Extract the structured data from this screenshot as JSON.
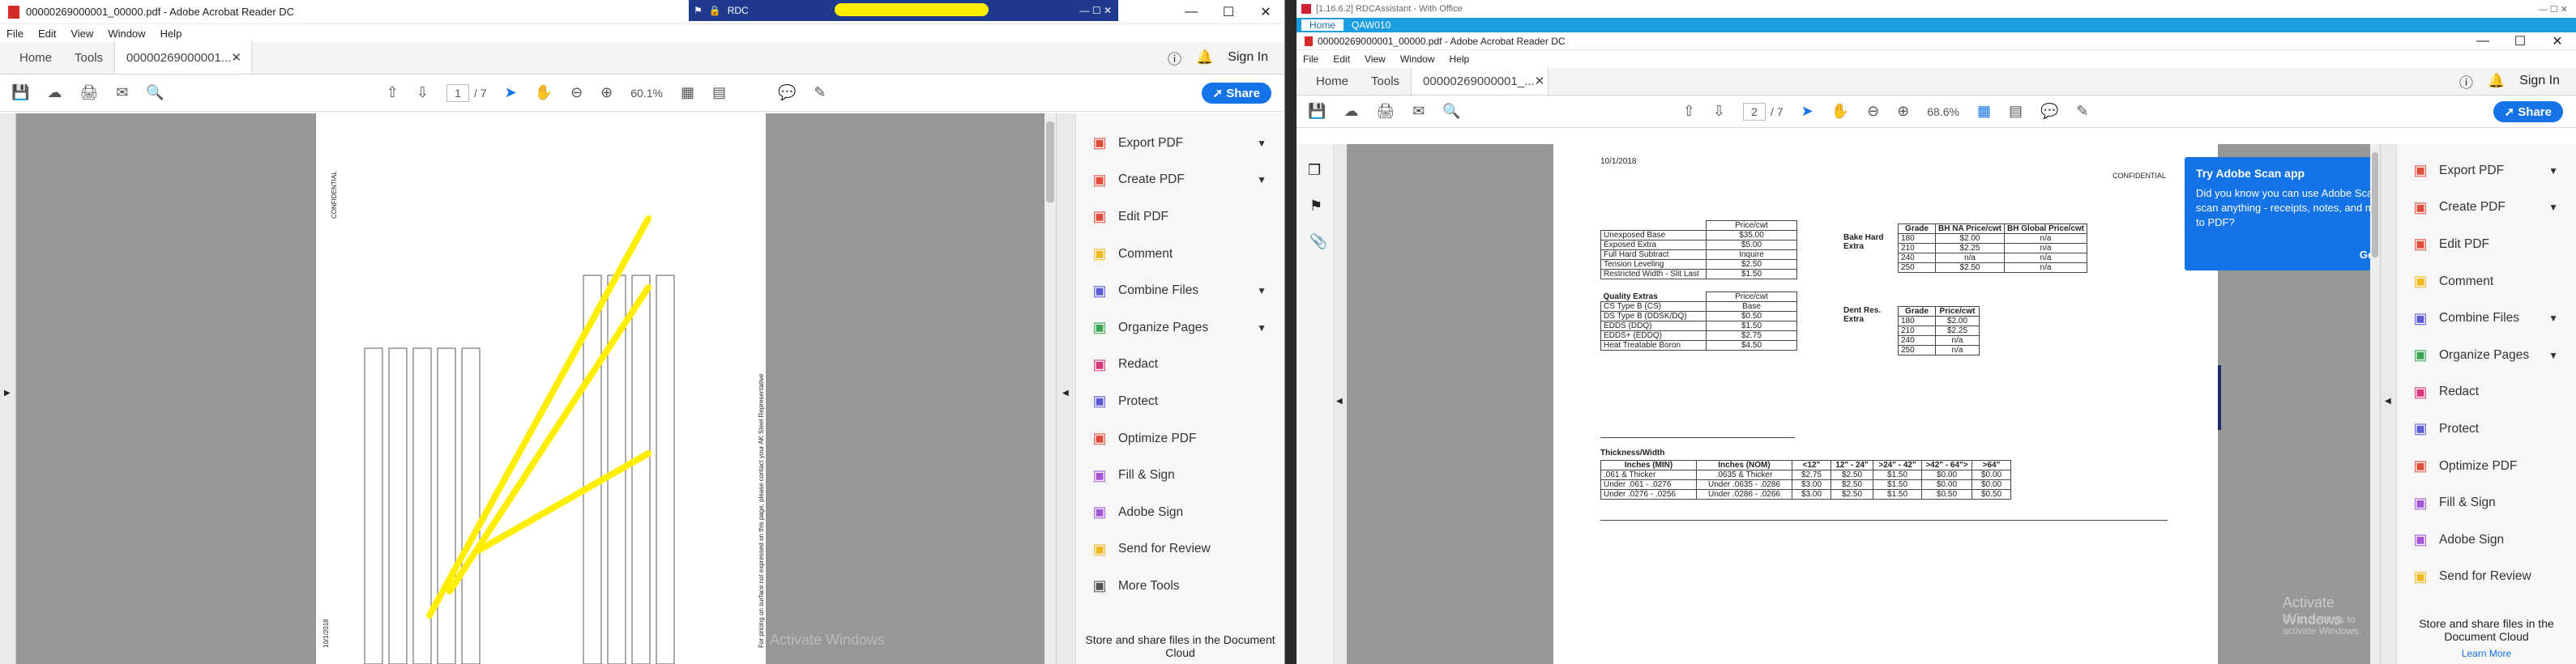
{
  "left_window": {
    "title": "00000269000001_00000.pdf - Adobe Acrobat Reader DC",
    "menu": [
      "File",
      "Edit",
      "View",
      "Window",
      "Help"
    ],
    "tabs": {
      "home": "Home",
      "tools": "Tools",
      "doc": "00000269000001..."
    },
    "sign_in": "Sign In",
    "page_current": "1",
    "page_total": "/ 7",
    "zoom": "60.1%",
    "share": "Share",
    "tools": [
      {
        "label": "Export PDF",
        "icon": "export-pdf-icon",
        "color": "#e24c3c",
        "chev": true
      },
      {
        "label": "Create PDF",
        "icon": "create-pdf-icon",
        "color": "#e24c3c",
        "chev": true
      },
      {
        "label": "Edit PDF",
        "icon": "edit-pdf-icon",
        "color": "#e24c3c",
        "chev": false
      },
      {
        "label": "Comment",
        "icon": "comment-icon",
        "color": "#f2b820",
        "chev": false
      },
      {
        "label": "Combine Files",
        "icon": "combine-files-icon",
        "color": "#5b5bd6",
        "chev": true
      },
      {
        "label": "Organize Pages",
        "icon": "organize-pages-icon",
        "color": "#3aa655",
        "chev": true
      },
      {
        "label": "Redact",
        "icon": "redact-icon",
        "color": "#d8357b",
        "chev": false
      },
      {
        "label": "Protect",
        "icon": "protect-icon",
        "color": "#5b5bd6",
        "chev": false
      },
      {
        "label": "Optimize PDF",
        "icon": "optimize-pdf-icon",
        "color": "#e24c3c",
        "chev": false
      },
      {
        "label": "Fill & Sign",
        "icon": "fill-sign-icon",
        "color": "#a456d6",
        "chev": false
      },
      {
        "label": "Adobe Sign",
        "icon": "adobe-sign-icon",
        "color": "#a456d6",
        "chev": false
      },
      {
        "label": "Send for Review",
        "icon": "send-review-icon",
        "color": "#f2b820",
        "chev": false
      },
      {
        "label": "More Tools",
        "icon": "more-tools-icon",
        "color": "#555555",
        "chev": false
      }
    ],
    "store_text": "Store and share files in the Document Cloud",
    "watermark": "Activate Windows",
    "page_side_text": "CONFIDENTIAL",
    "page_date": "10/1/2018",
    "page_footer": "For pricing on surface not expressed on this page, please contact your AK Steel Representative"
  },
  "remote_bar": {
    "label": "RDC"
  },
  "right_window": {
    "title": "[1.16.6.2] RDCAssistant - With Office",
    "ribbon_tabs": [
      "Home",
      "QAW010"
    ],
    "doc_title": "00000269000001_00000.pdf - Adobe Acrobat Reader DC",
    "menu": [
      "File",
      "Edit",
      "View",
      "Window",
      "Help"
    ],
    "tabs": {
      "home": "Home",
      "tools": "Tools",
      "doc": "00000269000001_..."
    },
    "sign_in": "Sign In",
    "page_current": "2",
    "page_total": "/ 7",
    "zoom": "68.6%",
    "share": "Share",
    "tools": [
      {
        "label": "Export PDF",
        "icon": "export-pdf-icon",
        "color": "#e24c3c",
        "chev": true
      },
      {
        "label": "Create PDF",
        "icon": "create-pdf-icon",
        "color": "#e24c3c",
        "chev": true
      },
      {
        "label": "Edit PDF",
        "icon": "edit-pdf-icon",
        "color": "#e24c3c",
        "chev": false
      },
      {
        "label": "Comment",
        "icon": "comment-icon",
        "color": "#f2b820",
        "chev": false
      },
      {
        "label": "Combine Files",
        "icon": "combine-files-icon",
        "color": "#5b5bd6",
        "chev": true
      },
      {
        "label": "Organize Pages",
        "icon": "organize-pages-icon",
        "color": "#3aa655",
        "chev": true
      },
      {
        "label": "Redact",
        "icon": "redact-icon",
        "color": "#d8357b",
        "chev": false
      },
      {
        "label": "Protect",
        "icon": "protect-icon",
        "color": "#5b5bd6",
        "chev": false
      },
      {
        "label": "Optimize PDF",
        "icon": "optimize-pdf-icon",
        "color": "#e24c3c",
        "chev": false
      },
      {
        "label": "Fill & Sign",
        "icon": "fill-sign-icon",
        "color": "#a456d6",
        "chev": false
      },
      {
        "label": "Adobe Sign",
        "icon": "adobe-sign-icon",
        "color": "#a456d6",
        "chev": false
      },
      {
        "label": "Send for Review",
        "icon": "send-review-icon",
        "color": "#f2b820",
        "chev": false
      }
    ],
    "store_text": "Store and share files in the Document Cloud",
    "learn_more": "Learn More",
    "popup": {
      "title": "Try Adobe Scan app",
      "body": "Did you know you can use Adobe Scan to scan anything - receipts, notes, and more - to PDF?",
      "cta": "Get App"
    },
    "page": {
      "date": "10/1/2018",
      "conf": "CONFIDENTIAL",
      "base_table": {
        "header": [
          "",
          "Price/cwt"
        ],
        "rows": [
          [
            "Unexposed Base",
            "$35.00"
          ],
          [
            "Exposed Extra",
            "$5.00"
          ],
          [
            "Full Hard Subtract",
            "Inquire"
          ],
          [
            "Tension Leveling",
            "$2.50"
          ],
          [
            "Restricted Width - Slit Last",
            "$1.50"
          ]
        ]
      },
      "quality_table": {
        "header": [
          "Quality Extras",
          "Price/cwt"
        ],
        "rows": [
          [
            "CS Type B (CS)",
            "Base"
          ],
          [
            "DS Type B (DDSK/DQ)",
            "$0.50"
          ],
          [
            "EDDS (DDQ)",
            "$1.50"
          ],
          [
            "EDDS+ (EDDQ)",
            "$2.75"
          ],
          [
            "Heat Treatable Boron",
            "$4.50"
          ]
        ]
      },
      "bake_table": {
        "label": "Bake Hard Extra",
        "header": [
          "Grade",
          "BH NA Price/cwt",
          "BH Global Price/cwt"
        ],
        "rows": [
          [
            "180",
            "$2.00",
            "n/a"
          ],
          [
            "210",
            "$2.25",
            "n/a"
          ],
          [
            "240",
            "n/a",
            "n/a"
          ],
          [
            "250",
            "$2.50",
            "n/a"
          ]
        ]
      },
      "dent_table": {
        "label": "Dent Res. Extra",
        "header": [
          "Grade",
          "Price/cwt"
        ],
        "rows": [
          [
            "180",
            "$2.00"
          ],
          [
            "210",
            "$2.25"
          ],
          [
            "240",
            "n/a"
          ],
          [
            "250",
            "n/a"
          ]
        ]
      },
      "thick_table": {
        "label": "Thickness/Width",
        "header": [
          "Inches (MIN)",
          "Inches (NOM)",
          "<12\"",
          "12\" - 24\"",
          ">24\" - 42\"",
          ">42\" - 64\">",
          ">64\""
        ],
        "rows": [
          [
            ".061 & Thicker",
            ".0635 & Thicker",
            "$2.75",
            "$2.50",
            "$1.50",
            "$0.00",
            "$0.00"
          ],
          [
            "Under .061 - .0276",
            "Under .0635 - .0286",
            "$3.00",
            "$2.50",
            "$1.50",
            "$0.00",
            "$0.00"
          ],
          [
            "Under .0276 - .0256",
            "Under .0286 - .0266",
            "$3.00",
            "$2.50",
            "$1.50",
            "$0.50",
            "$0.50"
          ]
        ]
      }
    },
    "watermark": "Activate Windows",
    "watermark_sub": "Go to Settings to activate Windows."
  }
}
